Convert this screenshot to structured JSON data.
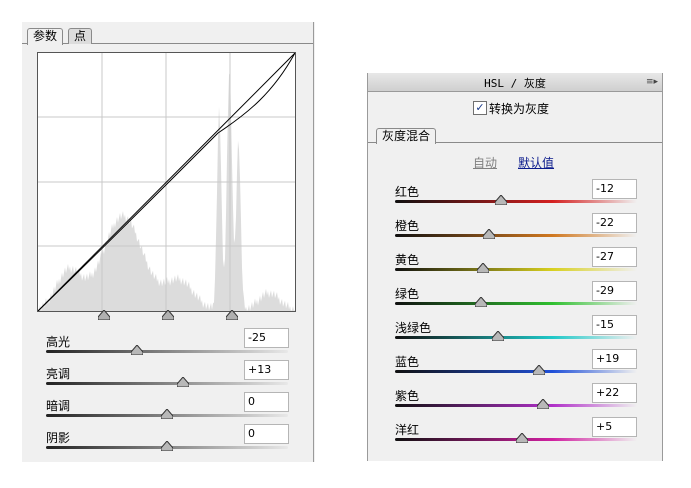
{
  "curves_panel": {
    "tabs": [
      {
        "label": "参数",
        "active": true
      },
      {
        "label": "点",
        "active": false
      }
    ],
    "sliders": [
      {
        "label": "高光",
        "value": "-25",
        "amount": -25
      },
      {
        "label": "亮调",
        "value": "+13",
        "amount": 13
      },
      {
        "label": "暗调",
        "value": "0",
        "amount": 0
      },
      {
        "label": "阴影",
        "value": "0",
        "amount": 0
      }
    ]
  },
  "hsl_panel": {
    "title": "HSL / 灰度",
    "menu_icon": "panel-menu-icon",
    "convert_to_gray": {
      "label": "转换为灰度",
      "checked": true
    },
    "tab": "灰度混合",
    "auto_label": "自动",
    "default_label": "默认值",
    "sliders": [
      {
        "label": "红色",
        "value": "-12",
        "amount": -12,
        "colors": [
          "#101010",
          "#d42020"
        ]
      },
      {
        "label": "橙色",
        "value": "-22",
        "amount": -22,
        "colors": [
          "#101010",
          "#d07820"
        ]
      },
      {
        "label": "黄色",
        "value": "-27",
        "amount": -27,
        "colors": [
          "#101010",
          "#d8d020"
        ]
      },
      {
        "label": "绿色",
        "value": "-29",
        "amount": -29,
        "colors": [
          "#101010",
          "#30c030"
        ]
      },
      {
        "label": "浅绿色",
        "value": "-15",
        "amount": -15,
        "colors": [
          "#101010",
          "#20c8c8"
        ]
      },
      {
        "label": "蓝色",
        "value": "+19",
        "amount": 19,
        "colors": [
          "#101010",
          "#2050d8"
        ]
      },
      {
        "label": "紫色",
        "value": "+22",
        "amount": 22,
        "colors": [
          "#101010",
          "#b030c8"
        ]
      },
      {
        "label": "洋红",
        "value": "+5",
        "amount": 5,
        "colors": [
          "#101010",
          "#d020a0"
        ]
      }
    ]
  }
}
